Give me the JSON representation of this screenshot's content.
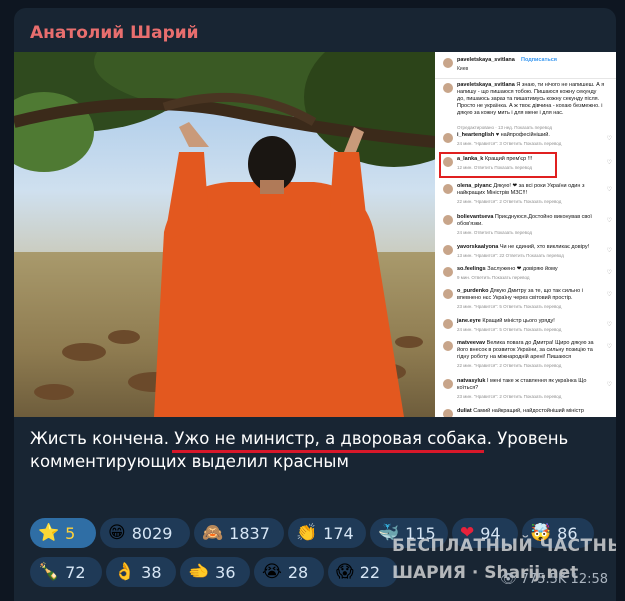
{
  "post": {
    "author": "Анатолий Шарий",
    "caption_part1": "Жисть кончена. ",
    "caption_highlight": "Ужо не министр, а дворовая собака",
    "caption_part2": ". Уровень комментирующих выделил красным",
    "views": "775.5K",
    "time": "12:58"
  },
  "instagram": {
    "username": "paveletskaya_svitlana",
    "follow_label": "Подписаться",
    "location": "Киев",
    "caption_user": "paveletskaya_svitlana",
    "caption_text": "Я знаю, ти нічого не напишеш. А я напишу - що пишаюся тобою. Пишаюся кожну секунду до, пишаюсь зараз та пишатимусь кожну секунду після. Просто не українка. А ж твоє дівчина - кохаю безмежно. і дякую за кожну мить і для мене і для нас.",
    "caption_meta": "Отредактировано · 13 нед.   Показать перевод",
    "comments": [
      {
        "user": "i_heartenglish",
        "text": "♥ найпрофесійніший.",
        "meta": "24 мин.   \"Нравится\": 3   Ответить   Показать перевод"
      },
      {
        "user": "a_lanka_k",
        "text": "Кращий прем'єр !!!",
        "meta": "12 мин.   Ответить   Показать перевод"
      },
      {
        "user": "olena_piyanc",
        "text": "Дякую! ❤ за всі роки України один з найкращих Міністрів МЗС!!!",
        "meta": "22 мин.   \"Нравится\": 2   Ответить   Показать перевод"
      },
      {
        "user": "bolievantseva",
        "text": "Приєднуюся.Достойно виконував свої обов'язки.",
        "meta": "24 мин.   Ответить   Показать перевод"
      },
      {
        "user": "yavorskaalyona",
        "text": "Чи не єдиний, хто викликає довіру!",
        "meta": "13 мин.   \"Нравится\": 22   Ответить   Показать перевод"
      },
      {
        "user": "so.feelings",
        "text": "Заслужено ❤ довіряю йому",
        "meta": "9 мин.   Ответить   Показать перевод"
      },
      {
        "user": "o_purdenko",
        "text": "Дякую Дмитру за те, що так сильно і впевнено нєс Україну через світовий простір.",
        "meta": "23 мин.   \"Нравится\": 5   Ответить   Показать перевод"
      },
      {
        "user": "jane.eyre",
        "text": "Кращий міністр цього уряду!",
        "meta": "24 мин.   \"Нравится\": 5   Ответить   Показать перевод"
      },
      {
        "user": "matveevav",
        "text": "Велика повага до Дмитра! Щиро дякую за його внесок в розвиток України, за сильну позицію та гідну роботу на міжнародній арені! Пишаюся",
        "meta": "22 мин.   \"Нравится\": 2   Ответить   Показать перевод"
      },
      {
        "user": "natvasyluk",
        "text": "І мені таке ж ставлення як українка Що коїться?",
        "meta": "23 мин.   \"Нравится\": 2   Ответить   Показать перевод"
      },
      {
        "user": "duliat",
        "text": "Самий найкращий, найдостойніший міністр",
        "meta": ""
      }
    ]
  },
  "reactions": [
    {
      "icon": "star",
      "emoji": "⭐",
      "count": "5",
      "selected": true
    },
    {
      "icon": "grin",
      "emoji": "😁",
      "count": "8029"
    },
    {
      "icon": "see-no-evil-monkey",
      "emoji": "🙈",
      "count": "1837"
    },
    {
      "icon": "clapping-hands",
      "emoji": "👏",
      "count": "174"
    },
    {
      "icon": "whale",
      "emoji": "🐳",
      "count": "115"
    },
    {
      "icon": "red-heart",
      "emoji": "❤",
      "count": "94"
    },
    {
      "icon": "exploding-head",
      "emoji": "🤯",
      "count": "86"
    },
    {
      "icon": "champagne",
      "emoji": "🍾",
      "count": "72"
    },
    {
      "icon": "ok-hand",
      "emoji": "👌",
      "count": "38"
    },
    {
      "icon": "left-hand",
      "emoji": "🫲",
      "count": "36"
    },
    {
      "icon": "crying-face",
      "emoji": "😭",
      "count": "28"
    },
    {
      "icon": "screaming-face",
      "emoji": "😱",
      "count": "22"
    }
  ],
  "watermark": {
    "line1": "БЕСПЛАТНЫЙ ЧАСТНЫЙ",
    "line2": "ШАРИЯ · Sharij.net"
  }
}
